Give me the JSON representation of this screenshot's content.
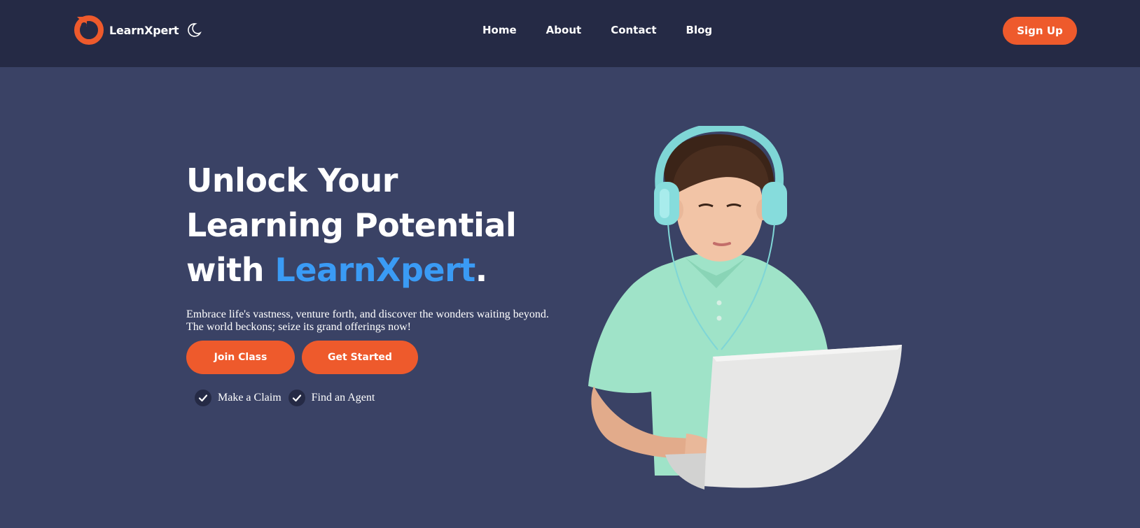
{
  "navbar": {
    "brand": "LearnXpert",
    "links": [
      "Home",
      "About",
      "Contact",
      "Blog"
    ],
    "signup_label": "Sign Up",
    "logo_icon": "logo-ring-icon",
    "theme_icon": "moon-icon"
  },
  "hero": {
    "title_line1": "Unlock Your",
    "title_line2": "Learning Potential",
    "title_line3_prefix": "with ",
    "title_accent": "LearnXpert",
    "title_suffix": ".",
    "subtitle_line1": "Embrace life's vastness, venture forth, and discover the wonders waiting beyond.",
    "subtitle_line2": "The world beckons; seize its grand offerings now!",
    "buttons": [
      "Join Class",
      "Get Started"
    ],
    "features": [
      "Make a Claim",
      "Find an Agent"
    ],
    "image": "boy-with-headphones-and-laptop"
  },
  "colors": {
    "page_bg": "#3a4265",
    "nav_bg": "#252a45",
    "accent_orange": "#ee5a2c",
    "accent_blue": "#3a9bf5"
  }
}
